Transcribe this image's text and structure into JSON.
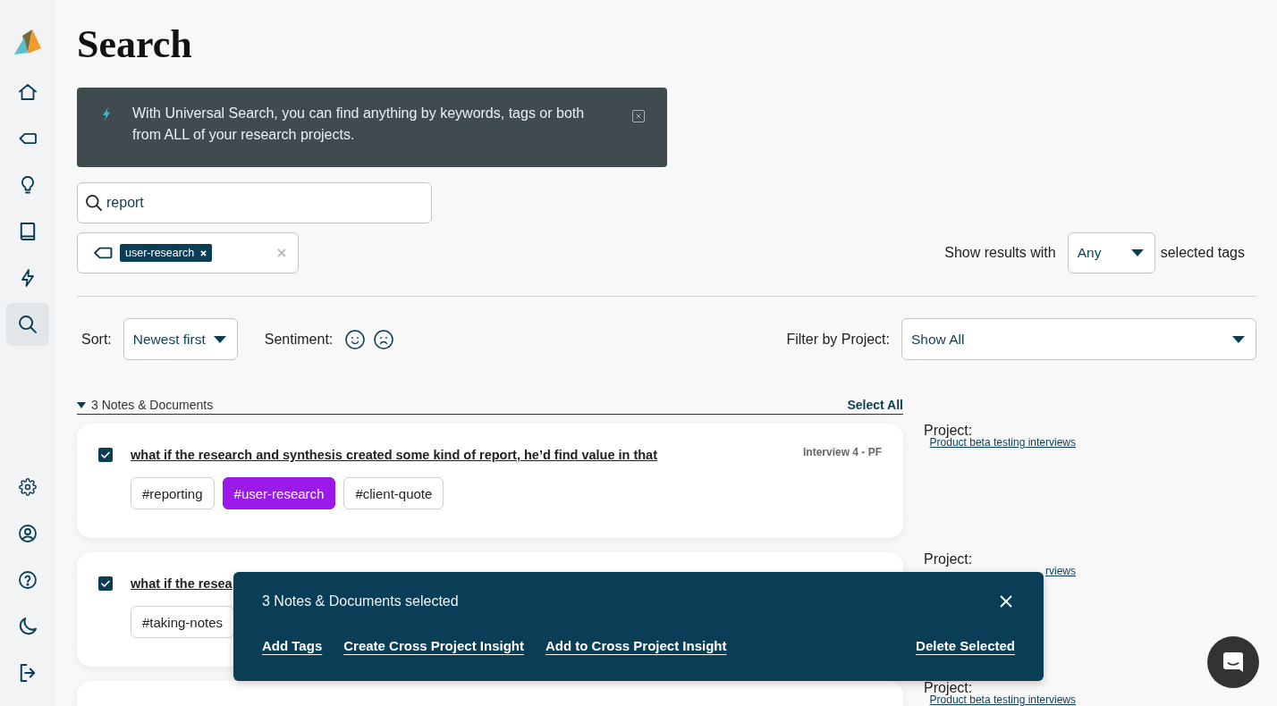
{
  "sidebar": {
    "nav_items": [
      {
        "selected": false
      },
      {
        "selected": false
      },
      {
        "selected": false
      },
      {
        "selected": false
      },
      {
        "selected": false
      },
      {
        "selected": true
      }
    ]
  },
  "page_title": "Search",
  "banner": {
    "text": "With Universal Search, you can find anything by keywords, tags or both from ALL of your research projects."
  },
  "search": {
    "value": "report"
  },
  "tag_filter": {
    "chips": [
      "user-research"
    ]
  },
  "tag_match": {
    "label": "Show results with",
    "value": "Any",
    "suffix": "selected tags"
  },
  "sort": {
    "label": "Sort:",
    "value": "Newest first"
  },
  "sentiment": {
    "label": "Sentiment:"
  },
  "project_filter": {
    "label": "Filter by Project:",
    "value": "Show All"
  },
  "results": {
    "heading": "3 Notes & Documents",
    "expanded": true,
    "select_all": "Select All",
    "items": [
      {
        "checked": true,
        "title": "what if the research and synthesis created some kind of report, he’d find value in that",
        "source": "Interview 4 - PF",
        "tags": [
          {
            "label": "#reporting",
            "highlighted": false
          },
          {
            "label": "#user-research",
            "highlighted": true
          },
          {
            "label": "#client-quote",
            "highlighted": false
          }
        ],
        "project_label": "Project:",
        "project_link": "Product beta testing interviews"
      },
      {
        "checked": true,
        "title": "what if the resea",
        "tags": [
          {
            "label": "#taking-notes",
            "highlighted": false
          }
        ],
        "project_label": "Project:",
        "project_link": "rviews"
      },
      {
        "project_label": "Project:",
        "project_link": "Product beta testing interviews"
      }
    ]
  },
  "selection_bar": {
    "title": "3 Notes & Documents selected",
    "actions": [
      "Add Tags",
      "Create Cross Project Insight",
      "Add to Cross Project Insight"
    ],
    "delete_action": "Delete Selected"
  }
}
